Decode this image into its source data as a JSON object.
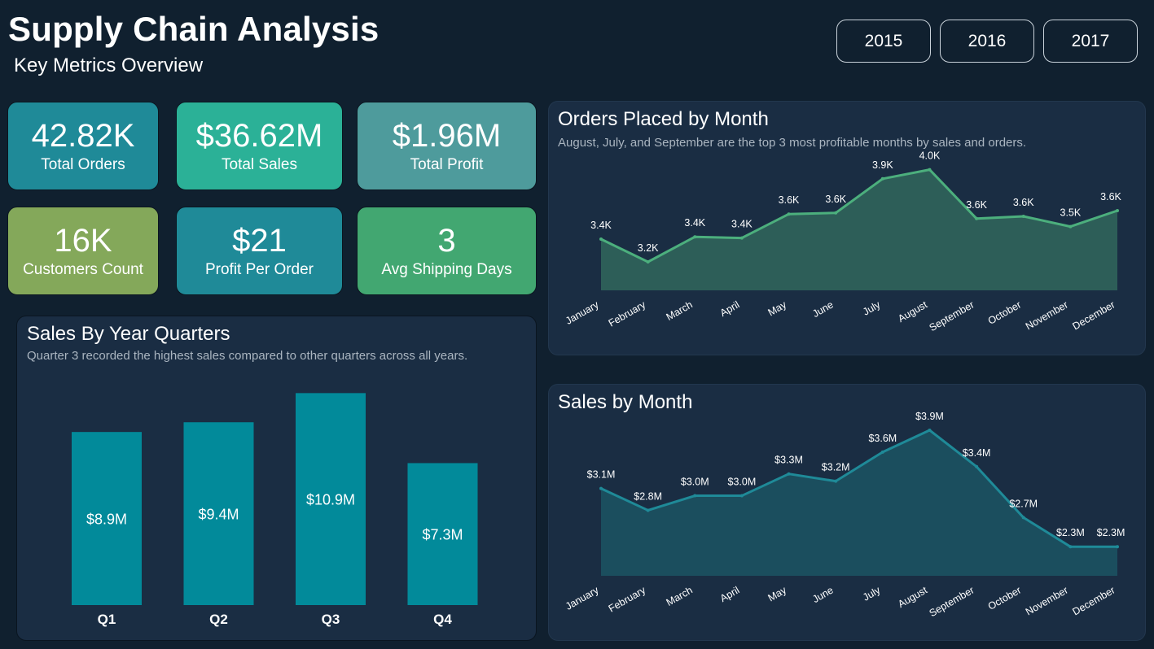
{
  "header": {
    "title": "Supply Chain Analysis",
    "subtitle": "Key Metrics Overview",
    "years": [
      "2015",
      "2016",
      "2017"
    ]
  },
  "kpis": [
    {
      "value": "42.82K",
      "label": "Total Orders",
      "color": "#1f8a98"
    },
    {
      "value": "$36.62M",
      "label": "Total Sales",
      "color": "#2bb197"
    },
    {
      "value": "$1.96M",
      "label": "Total Profit",
      "color": "#4e9b9c"
    },
    {
      "value": "16K",
      "label": "Customers Count",
      "color": "#84a85a"
    },
    {
      "value": "$21",
      "label": "Profit Per Order",
      "color": "#1f8a98"
    },
    {
      "value": "3",
      "label": "Avg Shipping Days",
      "color": "#42a771"
    }
  ],
  "panels": {
    "quarters": {
      "title": "Sales By Year Quarters",
      "subtitle": "Quarter 3 recorded the highest sales compared to other quarters across all years."
    },
    "orders": {
      "title": "Orders Placed by Month",
      "subtitle": "August, July, and September are the top 3 most profitable months by sales and orders."
    },
    "sales": {
      "title": "Sales by Month",
      "subtitle": ""
    }
  },
  "chart_data": [
    {
      "type": "bar",
      "title": "Sales By Year Quarters",
      "categories": [
        "Q1",
        "Q2",
        "Q3",
        "Q4"
      ],
      "values": [
        8.9,
        9.4,
        10.9,
        7.3
      ],
      "labels": [
        "$8.9M",
        "$9.4M",
        "$10.9M",
        "$7.3M"
      ],
      "ylim": [
        0,
        11.5
      ],
      "color": "#028a9a"
    },
    {
      "type": "area",
      "title": "Orders Placed by Month",
      "categories": [
        "January",
        "February",
        "March",
        "April",
        "May",
        "June",
        "July",
        "August",
        "September",
        "October",
        "November",
        "December"
      ],
      "values": [
        3.35,
        3.15,
        3.37,
        3.36,
        3.57,
        3.58,
        3.88,
        3.96,
        3.53,
        3.55,
        3.46,
        3.6
      ],
      "labels": [
        "3.4K",
        "3.2K",
        "3.4K",
        "3.4K",
        "3.6K",
        "3.6K",
        "3.9K",
        "4.0K",
        "3.6K",
        "3.6K",
        "3.5K",
        "3.6K"
      ],
      "ylim": [
        2.9,
        4.0
      ],
      "line_color": "#4caf7d",
      "fill_color": "#2d5e58"
    },
    {
      "type": "area",
      "title": "Sales by Month",
      "categories": [
        "January",
        "February",
        "March",
        "April",
        "May",
        "June",
        "July",
        "August",
        "September",
        "October",
        "November",
        "December"
      ],
      "values": [
        3.1,
        2.8,
        3.0,
        3.0,
        3.3,
        3.2,
        3.6,
        3.9,
        3.4,
        2.7,
        2.3,
        2.3
      ],
      "labels": [
        "$3.1M",
        "$2.8M",
        "$3.0M",
        "$3.0M",
        "$3.3M",
        "$3.2M",
        "$3.6M",
        "$3.9M",
        "$3.4M",
        "$2.7M",
        "$2.3M",
        "$2.3M"
      ],
      "ylim": [
        1.9,
        3.9
      ],
      "line_color": "#1f8a98",
      "fill_color": "#1b4e5e"
    }
  ]
}
